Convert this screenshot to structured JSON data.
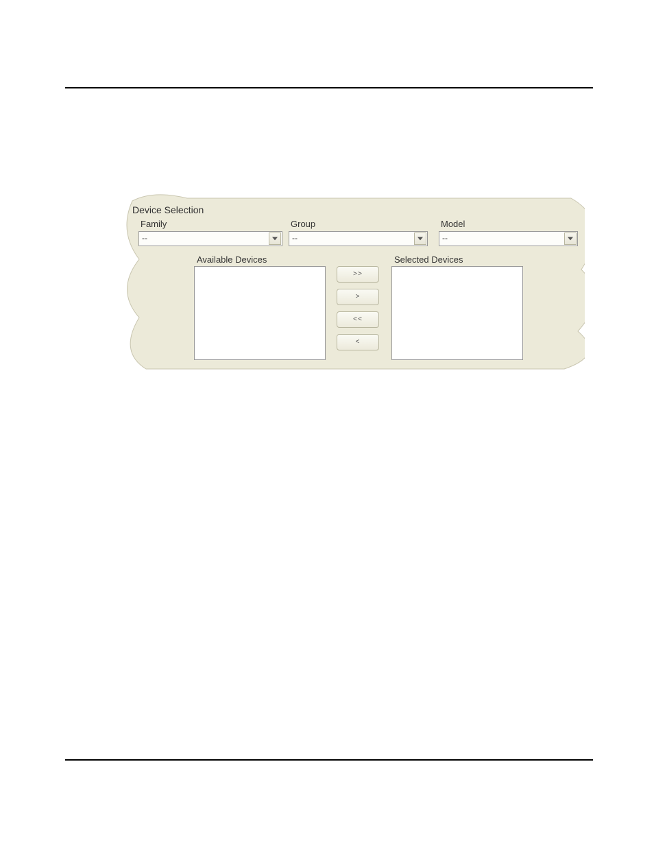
{
  "panel": {
    "title": "Device Selection",
    "family": {
      "label": "Family",
      "value": "--"
    },
    "group": {
      "label": "Group",
      "value": "--"
    },
    "model": {
      "label": "Model",
      "value": "--"
    },
    "available_label": "Available Devices",
    "selected_label": "Selected Devices",
    "buttons": {
      "add_all": ">>",
      "add_one": ">",
      "remove_all": "<<",
      "remove_one": "<"
    },
    "available_items": [],
    "selected_items": []
  },
  "colors": {
    "panel_bg": "#ecead9",
    "panel_border": "#ccc9b3"
  }
}
